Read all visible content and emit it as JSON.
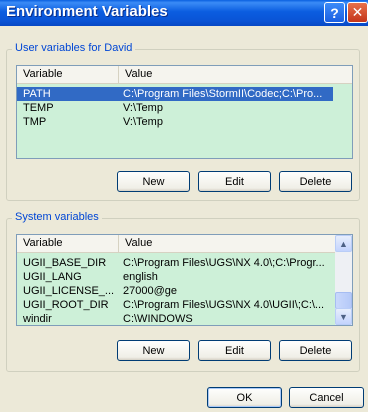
{
  "window": {
    "title": "Environment Variables",
    "help_glyph": "?",
    "close_glyph": "✕"
  },
  "user_group": {
    "label": "User variables for David",
    "columns": [
      "Variable",
      "Value"
    ],
    "rows": [
      {
        "name": "PATH",
        "value": "C:\\Program Files\\StormII\\Codec;C:\\Pro..."
      },
      {
        "name": "TEMP",
        "value": "V:\\Temp"
      },
      {
        "name": "TMP",
        "value": "V:\\Temp"
      }
    ],
    "buttons": {
      "new": "New",
      "edit": "Edit",
      "delete": "Delete"
    }
  },
  "system_group": {
    "label": "System variables",
    "columns": [
      "Variable",
      "Value"
    ],
    "rows": [
      {
        "name": "UGII_BASE_DIR",
        "value": "C:\\Program Files\\UGS\\NX 4.0\\;C:\\Progr..."
      },
      {
        "name": "UGII_LANG",
        "value": "english"
      },
      {
        "name": "UGII_LICENSE_...",
        "value": "27000@ge"
      },
      {
        "name": "UGII_ROOT_DIR",
        "value": "C:\\Program Files\\UGS\\NX 4.0\\UGII\\;C:\\..."
      },
      {
        "name": "windir",
        "value": "C:\\WINDOWS"
      }
    ],
    "scroll": {
      "up_glyph": "▲",
      "down_glyph": "▼"
    },
    "buttons": {
      "new": "New",
      "edit": "Edit",
      "delete": "Delete"
    }
  },
  "dialog_buttons": {
    "ok": "OK",
    "cancel": "Cancel"
  }
}
